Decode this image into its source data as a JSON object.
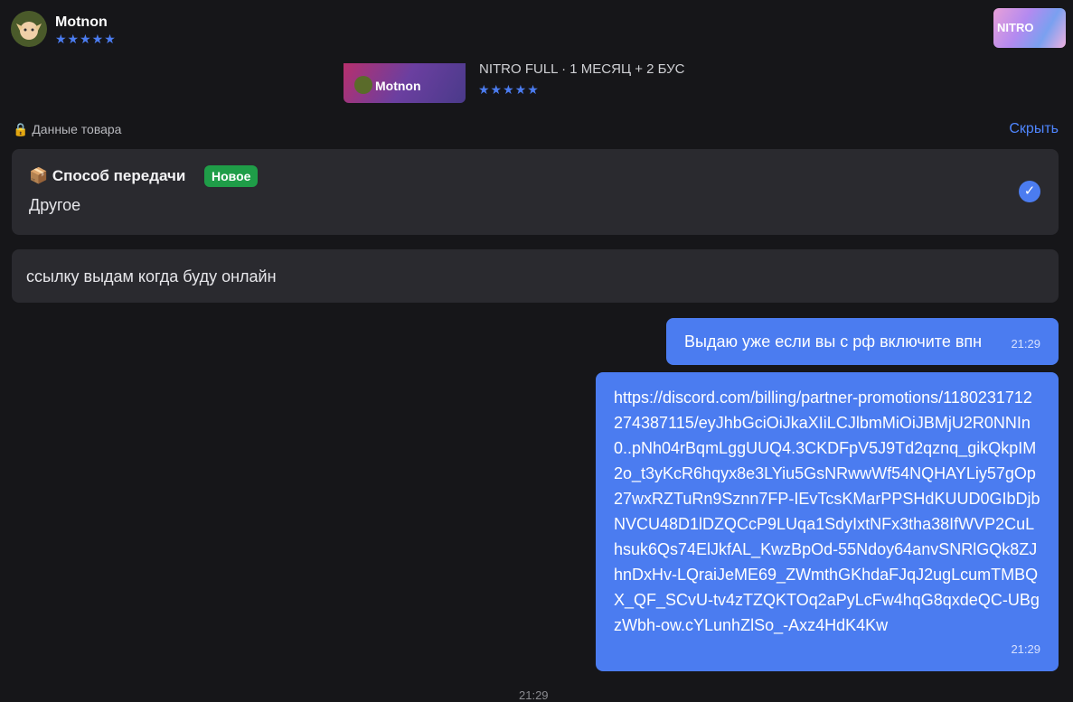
{
  "header": {
    "seller_name": "Motnon",
    "rating_stars": "★★★★★",
    "nitro_thumb_label": "NITRO"
  },
  "product": {
    "banner_label": "Motnon",
    "title": "NITRO FULL · 1 МЕСЯЦ + 2 БУС",
    "rating_stars": "★★★★★"
  },
  "details": {
    "section_label": "🔒 Данные товара",
    "hide_label": "Скрыть",
    "delivery_title": "📦 Способ передачи",
    "badge": "Новое",
    "delivery_value": "Другое",
    "check_icon": "✓"
  },
  "seller_note": "ссылку выдам когда буду онлайн",
  "messages": [
    {
      "text": "Выдаю уже если вы с рф включите впн",
      "time": "21:29"
    },
    {
      "text": "https://discord.com/billing/partner-promotions/1180231712274387115/eyJhbGciOiJkaXIiLCJlbmMiOiJBMjU2R0NNIn0..pNh04rBqmLggUUQ4.3CKDFpV5J9Td2qznq_gikQkpIM2o_t3yKcR6hqyx8e3LYiu5GsNRwwWf54NQHAYLiy57gOp27wxRZTuRn9Sznn7FP-IEvTcsKMarPPSHdKUUD0GIbDjbNVCU48D1lDZQCcP9LUqa1SdyIxtNFx3tha38IfWVP2CuLhsuk6Qs74ElJkfAL_KwzBpOd-55Ndoy64anvSNRlGQk8ZJhnDxHv-LQraiJeME69_ZWmthGKhdaFJqJ2ugLcumTMBQX_QF_SCvU-tv4zTZQKTOq2aPyLcFw4hqG8qxdeQC-UBgzWbh-ow.cYLunhZlSo_-Axz4HdK4Kw",
      "time": "21:29"
    }
  ],
  "bottom_time": "21:29",
  "colors": {
    "accent": "#4b7cf0",
    "badge_green": "#1f9d48",
    "background": "#161619",
    "card": "#2a2a2f"
  }
}
